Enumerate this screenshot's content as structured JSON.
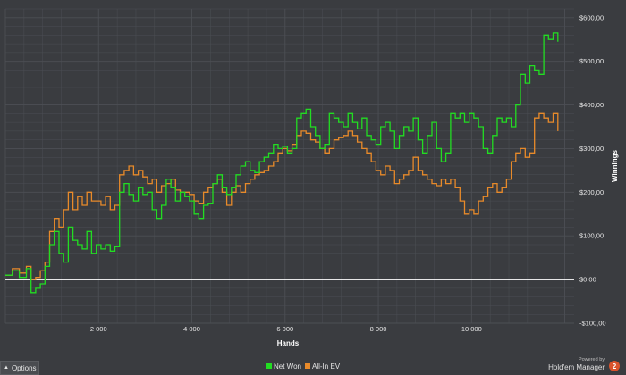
{
  "options_button": {
    "label": "Options",
    "icon": "caret-up-icon"
  },
  "branding": {
    "powered_by": "Powered by",
    "product": "Hold'em Manager",
    "version": "2"
  },
  "chart_data": {
    "type": "line",
    "xlabel": "Hands",
    "ylabel": "Winnings",
    "xlim": [
      0,
      12200
    ],
    "ylim": [
      -100,
      620
    ],
    "x_ticks": [
      2000,
      4000,
      6000,
      8000,
      10000
    ],
    "x_tick_labels": [
      "2 000",
      "4 000",
      "6 000",
      "8 000",
      "10 000"
    ],
    "y_ticks": [
      -100,
      0,
      100,
      200,
      300,
      400,
      500,
      600
    ],
    "y_tick_labels": [
      "-$100,00",
      "$0,00",
      "$100,00",
      "$200,00",
      "$300,00",
      "$400,00",
      "$500,00",
      "$600,00"
    ],
    "grid": true,
    "legend_position": "bottom-center",
    "colors": {
      "net_won": "#22dd22",
      "all_in_ev": "#e88a2a",
      "zero_line": "#ffffff",
      "background": "#3a3c40",
      "grid": "#4c4f54"
    },
    "series": [
      {
        "name": "Net Won",
        "x": [
          0,
          150,
          300,
          450,
          550,
          650,
          750,
          850,
          950,
          1050,
          1150,
          1250,
          1350,
          1450,
          1550,
          1650,
          1750,
          1850,
          1950,
          2050,
          2150,
          2250,
          2350,
          2450,
          2550,
          2650,
          2750,
          2850,
          2950,
          3050,
          3150,
          3250,
          3350,
          3450,
          3550,
          3650,
          3750,
          3850,
          3950,
          4050,
          4150,
          4250,
          4350,
          4450,
          4550,
          4650,
          4750,
          4850,
          4950,
          5050,
          5150,
          5250,
          5350,
          5450,
          5550,
          5650,
          5750,
          5850,
          5950,
          6050,
          6150,
          6250,
          6350,
          6450,
          6550,
          6650,
          6750,
          6850,
          6950,
          7050,
          7150,
          7250,
          7350,
          7450,
          7550,
          7650,
          7750,
          7850,
          7950,
          8050,
          8150,
          8250,
          8350,
          8450,
          8550,
          8650,
          8750,
          8850,
          8950,
          9050,
          9150,
          9250,
          9350,
          9450,
          9550,
          9650,
          9750,
          9850,
          9950,
          10050,
          10150,
          10250,
          10350,
          10450,
          10550,
          10650,
          10750,
          10850,
          10950,
          11050,
          11150,
          11250,
          11350,
          11450,
          11550,
          11650,
          11750,
          11850
        ],
        "y": [
          10,
          20,
          5,
          25,
          -30,
          -20,
          -10,
          30,
          80,
          110,
          60,
          40,
          120,
          90,
          80,
          70,
          110,
          60,
          80,
          70,
          80,
          65,
          75,
          200,
          220,
          195,
          180,
          210,
          195,
          200,
          160,
          140,
          170,
          230,
          210,
          180,
          200,
          190,
          180,
          150,
          140,
          170,
          175,
          220,
          240,
          210,
          195,
          210,
          240,
          260,
          270,
          250,
          245,
          270,
          280,
          290,
          310,
          300,
          305,
          290,
          300,
          370,
          380,
          390,
          350,
          330,
          300,
          310,
          380,
          370,
          360,
          350,
          380,
          360,
          345,
          370,
          330,
          320,
          310,
          350,
          360,
          340,
          300,
          330,
          350,
          340,
          370,
          320,
          290,
          330,
          360,
          300,
          270,
          290,
          380,
          370,
          380,
          360,
          380,
          370,
          350,
          300,
          290,
          330,
          370,
          360,
          370,
          350,
          400,
          470,
          450,
          490,
          480,
          470,
          560,
          550,
          565,
          545
        ]
      },
      {
        "name": "All-In EV",
        "x": [
          0,
          150,
          300,
          450,
          550,
          650,
          750,
          850,
          950,
          1050,
          1150,
          1250,
          1350,
          1450,
          1550,
          1650,
          1750,
          1850,
          1950,
          2050,
          2150,
          2250,
          2350,
          2450,
          2550,
          2650,
          2750,
          2850,
          2950,
          3050,
          3150,
          3250,
          3350,
          3450,
          3550,
          3650,
          3750,
          3850,
          3950,
          4050,
          4150,
          4250,
          4350,
          4450,
          4550,
          4650,
          4750,
          4850,
          4950,
          5050,
          5150,
          5250,
          5350,
          5450,
          5550,
          5650,
          5750,
          5850,
          5950,
          6050,
          6150,
          6250,
          6350,
          6450,
          6550,
          6650,
          6750,
          6850,
          6950,
          7050,
          7150,
          7250,
          7350,
          7450,
          7550,
          7650,
          7750,
          7850,
          7950,
          8050,
          8150,
          8250,
          8350,
          8450,
          8550,
          8650,
          8750,
          8850,
          8950,
          9050,
          9150,
          9250,
          9350,
          9450,
          9550,
          9650,
          9750,
          9850,
          9950,
          10050,
          10150,
          10250,
          10350,
          10450,
          10550,
          10650,
          10750,
          10850,
          10950,
          11050,
          11150,
          11250,
          11350,
          11450,
          11550,
          11650,
          11750,
          11850
        ],
        "y": [
          10,
          25,
          15,
          30,
          0,
          5,
          20,
          40,
          110,
          140,
          120,
          160,
          200,
          160,
          190,
          170,
          200,
          180,
          180,
          170,
          190,
          160,
          170,
          240,
          250,
          260,
          240,
          250,
          235,
          220,
          230,
          200,
          215,
          220,
          230,
          205,
          200,
          200,
          195,
          180,
          175,
          200,
          210,
          220,
          230,
          200,
          170,
          200,
          215,
          200,
          220,
          230,
          240,
          245,
          250,
          260,
          270,
          290,
          300,
          295,
          310,
          330,
          340,
          335,
          320,
          315,
          300,
          290,
          300,
          320,
          325,
          330,
          340,
          330,
          315,
          300,
          290,
          270,
          250,
          240,
          260,
          250,
          220,
          230,
          240,
          250,
          280,
          250,
          240,
          230,
          220,
          215,
          230,
          220,
          230,
          210,
          180,
          150,
          160,
          150,
          180,
          190,
          210,
          220,
          200,
          210,
          230,
          270,
          290,
          300,
          280,
          290,
          370,
          380,
          370,
          360,
          380,
          340
        ]
      }
    ]
  }
}
